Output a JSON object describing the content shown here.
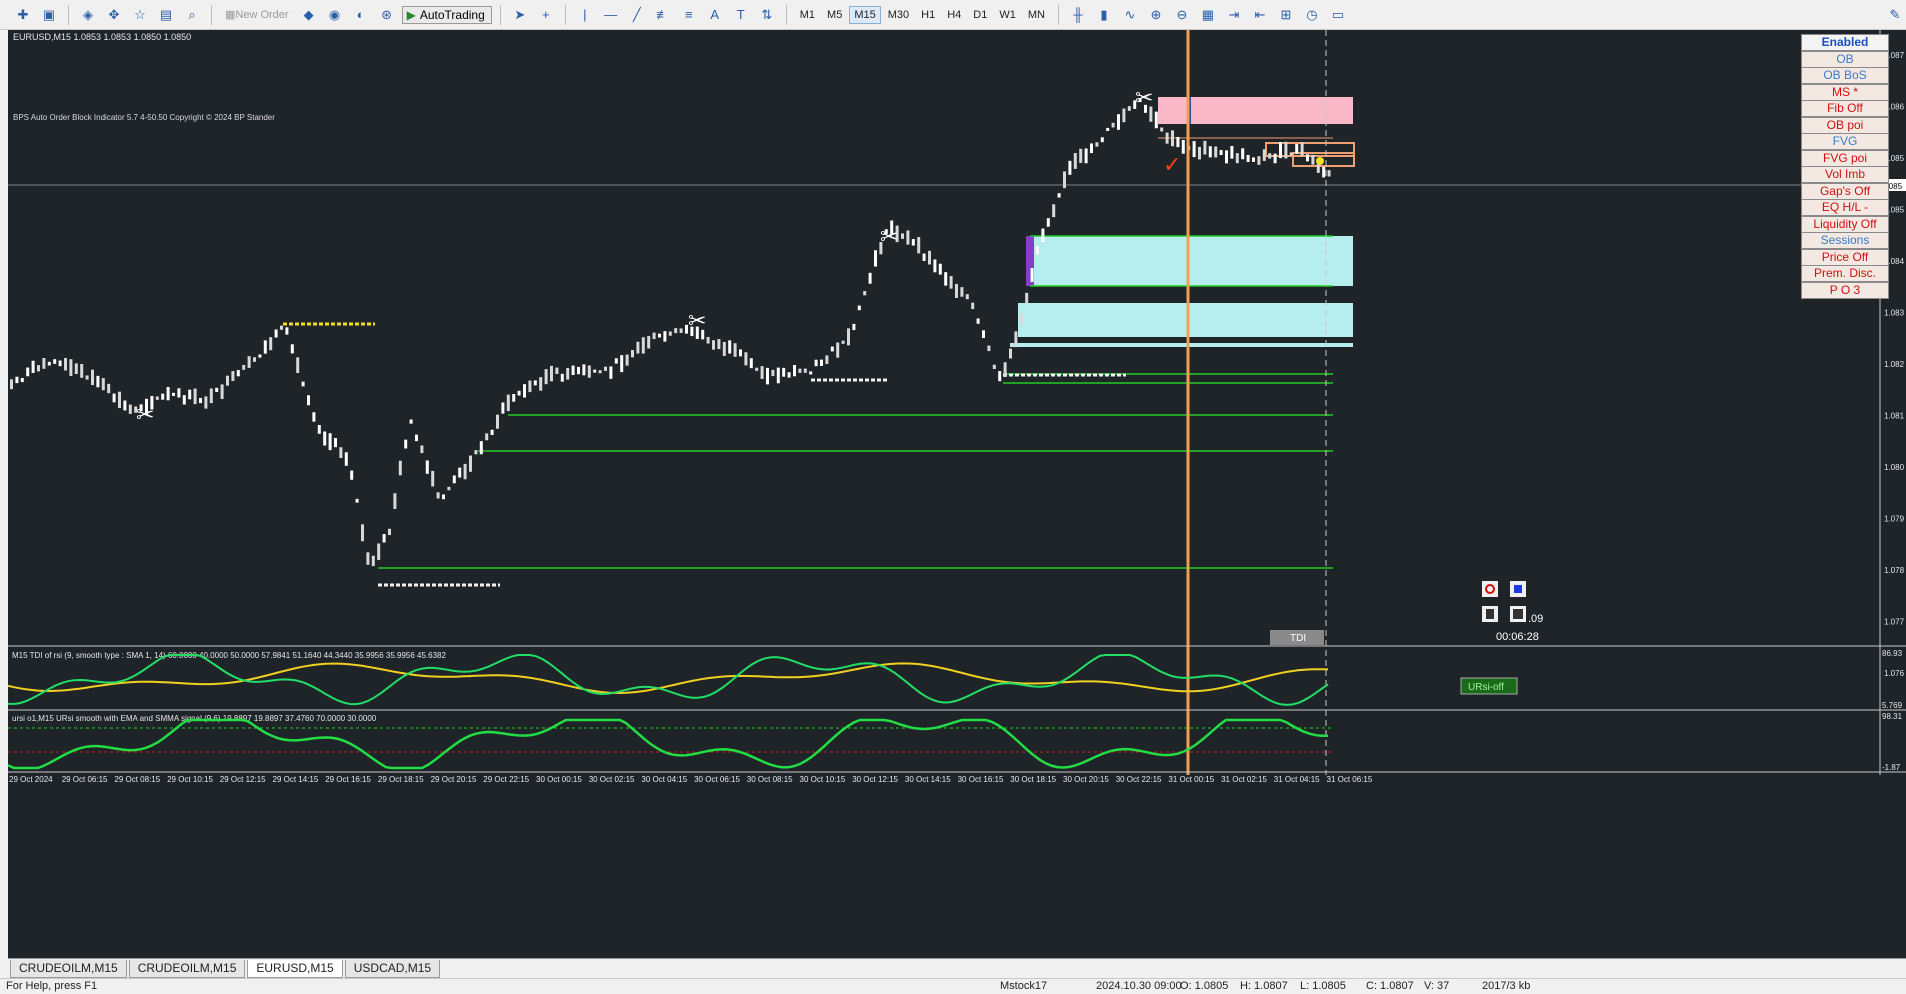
{
  "toolbar": {
    "new_order": "New Order",
    "autotrading": "AutoTrading",
    "timeframes": [
      "M1",
      "M5",
      "M15",
      "M30",
      "H1",
      "H4",
      "D1",
      "W1",
      "MN"
    ],
    "active_timeframe": "M15"
  },
  "chart": {
    "header": "EURUSD,M15  1.0853 1.0853 1.0850 1.0850",
    "indicator_caption": "BPS Auto Order Block Indicator  5.7 4-50.50 Copyright © 2024 BP Stander",
    "price_labels": [
      "1.087",
      "1.086",
      "1.085",
      "1.085",
      "1.084",
      "1.083",
      "1.082",
      "1.081",
      "1.080",
      "1.079",
      "1.078",
      "1.077",
      "1.076"
    ],
    "current_price_tag": "1.085",
    "time_labels": [
      "29 Oct 2024",
      "29 Oct 06:15",
      "29 Oct 08:15",
      "29 Oct 10:15",
      "29 Oct 12:15",
      "29 Oct 14:15",
      "29 Oct 16:15",
      "29 Oct 18:15",
      "29 Oct 20:15",
      "29 Oct 22:15",
      "30 Oct 00:15",
      "30 Oct 02:15",
      "30 Oct 04:15",
      "30 Oct 06:15",
      "30 Oct 08:15",
      "30 Oct 10:15",
      "30 Oct 12:15",
      "30 Oct 14:15",
      "30 Oct 16:15",
      "30 Oct 18:15",
      "30 Oct 20:15",
      "30 Oct 22:15",
      "31 Oct 00:15",
      "31 Oct 02:15",
      "31 Oct 04:15",
      "31 Oct 06:15"
    ],
    "timer": "00:06:28",
    "side_value": ".09",
    "tdi_button": "TDI",
    "colors": {
      "bg": "#1f2429",
      "accent": "#f0a050",
      "green": "#22cc22",
      "cyan": "#b6eef0",
      "pink": "#f8b8c8"
    }
  },
  "panel_buttons": [
    {
      "label": "Enabled",
      "color": "#1a4fc0"
    },
    {
      "label": "OB",
      "color": "#3a7ac8"
    },
    {
      "label": "OB BoS",
      "color": "#3a7ac8"
    },
    {
      "label": "MS *",
      "color": "#d01010"
    },
    {
      "label": "Fib Off",
      "color": "#d01010"
    },
    {
      "label": "OB poi",
      "color": "#d01010"
    },
    {
      "label": "FVG",
      "color": "#3a7ac8"
    },
    {
      "label": "FVG poi",
      "color": "#d01010"
    },
    {
      "label": "Vol Imb",
      "color": "#d01010"
    },
    {
      "label": "Gap's Off",
      "color": "#d01010"
    },
    {
      "label": "EQ H/L  -",
      "color": "#d01010"
    },
    {
      "label": "Liquidity Off",
      "color": "#d01010"
    },
    {
      "label": "Sessions",
      "color": "#3a7ac8"
    },
    {
      "label": "Price Off",
      "color": "#d01010"
    },
    {
      "label": "Prem. Disc.",
      "color": "#d01010"
    },
    {
      "label": "P O 3",
      "color": "#d01010"
    }
  ],
  "subwindow1": {
    "caption": "M15 TDI of rsi  (9, smooth type :  SMA 1, 14) 60.0000 40.0000 50.0000 57.9841 51.1640 44.3440 35.9956 35.9956 45.6382",
    "top_value": "86.93",
    "bottom_value": "5.769",
    "button": "URsi-off"
  },
  "subwindow2": {
    "caption": "ursi o1,M15 URsi smooth with EMA and SMMA signal (9,6) 19.8897 19.8897 37.4760 70.0000 30.0000",
    "top_value": "98.31",
    "bottom_value": "-1.87"
  },
  "tabs": [
    "CRUDEOILM,M15",
    "CRUDEOILM,M15",
    "EURUSD,M15",
    "USDCAD,M15"
  ],
  "active_tab": 2,
  "status": {
    "help": "For Help, press F1",
    "profile": "Mstock17",
    "datetime": "2024.10.30 09:00",
    "open": "O: 1.0805",
    "high": "H: 1.0807",
    "low": "L: 1.0805",
    "close": "C: 1.0807",
    "volume": "V: 37",
    "traffic": "2017/3 kb"
  }
}
